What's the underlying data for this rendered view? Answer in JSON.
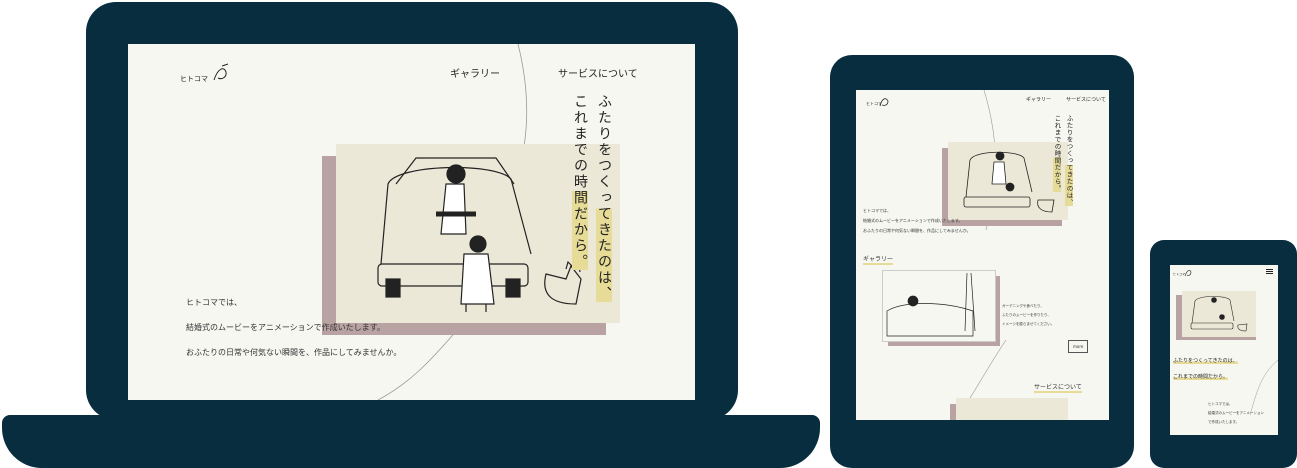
{
  "brand": {
    "logo_text": "ヒトコマ"
  },
  "nav": {
    "gallery": "ギャラリー",
    "service": "サービスについて"
  },
  "hero": {
    "copy_line1": "ふたりをつくってきたのは、",
    "copy_line2": "これまでの時間だから。"
  },
  "intro": {
    "line1": "ヒトコマでは、",
    "line2": "結婚式のムービーをアニメーションで作成いたします。",
    "line3": "おふたりの日常や何気ない瞬間を、作品にしてみませんか。"
  },
  "gallery_section": {
    "title": "ギャラリー",
    "desc1": "ガーデニングや食べたり、",
    "desc2": "ふたりのムービーを作りたり、",
    "desc3": "イメージを膨らませてください。",
    "more": "more"
  },
  "mobile": {
    "intro1": "ヒトコマでは、",
    "intro2": "結婚式のムービーをアニメーション",
    "intro3": "で作成いたします。"
  },
  "icons": {
    "menu": "hamburger-icon",
    "logo": "brush-logo-icon"
  },
  "colors": {
    "frame": "#072d3f",
    "screen": "#f6f7f1",
    "illustration": "#ece8d7",
    "shadow": "#b9a2a2",
    "highlight": "#e7dc97"
  }
}
